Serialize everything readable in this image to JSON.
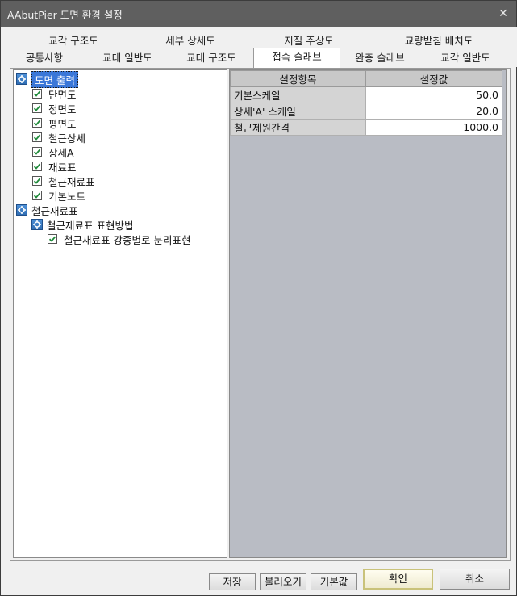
{
  "window": {
    "title": "AAbutPier 도면 환경 설정",
    "close_glyph": "✕"
  },
  "tabs": {
    "row1": [
      "교각 구조도",
      "세부 상세도",
      "지질 주상도",
      "교량받침 배치도"
    ],
    "row2": [
      "공통사항",
      "교대 일반도",
      "교대 구조도",
      "접속 슬래브",
      "완충 슬래브",
      "교각 일반도"
    ],
    "active": "접속 슬래브"
  },
  "tree": {
    "group1": {
      "label": "도면 출력",
      "icon": "settings-node-icon",
      "items": [
        {
          "label": "단면도",
          "checked": true
        },
        {
          "label": "정면도",
          "checked": true
        },
        {
          "label": "평면도",
          "checked": true
        },
        {
          "label": "철근상세",
          "checked": true
        },
        {
          "label": "상세A",
          "checked": true
        },
        {
          "label": "재료표",
          "checked": true
        },
        {
          "label": "철근재료표",
          "checked": true
        },
        {
          "label": "기본노트",
          "checked": true
        }
      ]
    },
    "group2": {
      "label": "철근재료표",
      "icon": "settings-node-icon",
      "sub": {
        "label": "철근재료표 표현방법",
        "items": [
          {
            "label": "철근재료표 강종별로 분리표현",
            "checked": true
          }
        ]
      }
    }
  },
  "grid": {
    "headers": [
      "설정항목",
      "설정값"
    ],
    "rows": [
      {
        "key": "기본스케일",
        "value": "50.0"
      },
      {
        "key": "상세'A' 스케일",
        "value": "20.0"
      },
      {
        "key": "철근제원간격",
        "value": "1000.0"
      }
    ]
  },
  "buttons": {
    "save": "저장",
    "load": "불러오기",
    "default": "기본값",
    "ok": "확인",
    "cancel": "취소"
  }
}
